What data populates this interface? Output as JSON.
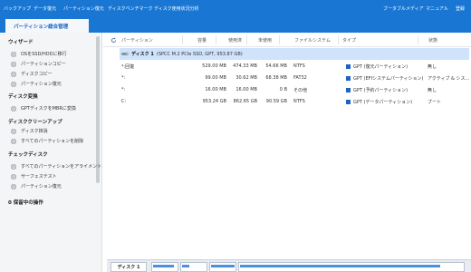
{
  "toolbar": {
    "backup": "バックアップ",
    "data_recovery": "データ復元",
    "partition_recovery": "パーティション復元",
    "disk_benchmark": "ディスクベンチマーク",
    "disk_usage": "ディスク使用状況分析",
    "bootable_media": "ブータブルメディア",
    "manual": "マニュアル",
    "register": "登録"
  },
  "tab": {
    "label": "パーティション総合管理"
  },
  "sidebar": {
    "sections": [
      {
        "title": "ウィザード",
        "items": [
          "OSをSSD/HDDに移行",
          "パーティションコピー",
          "ディスクコピー",
          "パーティション復元"
        ]
      },
      {
        "title": "ディスク変換",
        "items": [
          "GPTディスクをMBRに変換"
        ]
      },
      {
        "title": "ディスククリーンアップ",
        "items": [
          "ディスク抹消",
          "すべてのパーティションを削除"
        ]
      },
      {
        "title": "チェックディスク",
        "items": [
          "すべてのパーティションをアライメント",
          "サーフェステスト",
          "パーティション復元"
        ]
      }
    ],
    "icons": [
      "migrate-icon",
      "copy-icon",
      "disk-copy-icon",
      "restore-icon",
      "convert-icon",
      "wipe-icon",
      "delete-icon",
      "align-icon",
      "surface-test-icon",
      "restore-icon"
    ],
    "pending": "0 保留中の操作"
  },
  "columns": [
    "パーティション",
    "容量",
    "使用済",
    "未使用",
    "ファイルシステム",
    "タイプ",
    "状態"
  ],
  "disk": {
    "name": "ディスク 1",
    "desc": "(SPCC M.2 PCIe SSD, GPT, 953.87 GB)"
  },
  "partitions": [
    {
      "name": "*:回復",
      "capacity": "529.00 MB",
      "used": "474.33 MB",
      "unused": "54.66 MB",
      "fs": "NTFS",
      "type": "GPT (復元パーティション)",
      "status": "無し"
    },
    {
      "name": "*:",
      "capacity": "99.00 MB",
      "used": "30.62 MB",
      "unused": "68.38 MB",
      "fs": "FAT32",
      "type": "GPT (EFIシステムパーティション)",
      "status": "アクティブ & シス..."
    },
    {
      "name": "*:",
      "capacity": "16.00 MB",
      "used": "16.00 MB",
      "unused": "0 B",
      "fs": "その他",
      "type": "GPT (予約パーティション)",
      "status": "無し"
    },
    {
      "name": "C:",
      "capacity": "953.24 GB",
      "used": "862.65 GB",
      "unused": "90.59 GB",
      "fs": "NTFS",
      "type": "GPT (データパーティション)",
      "status": "ブート"
    }
  ],
  "diskmap": {
    "label": "ディスク 1",
    "segments": [
      {
        "used_fraction": 0.9
      },
      {
        "used_fraction": 0.31
      },
      {
        "used_fraction": 1.0
      },
      {
        "used_fraction": 0.9
      }
    ]
  },
  "colors": {
    "accent": "#1976d2",
    "selected_row": "#cfe3fb",
    "type_icon": "#1e63c4"
  }
}
